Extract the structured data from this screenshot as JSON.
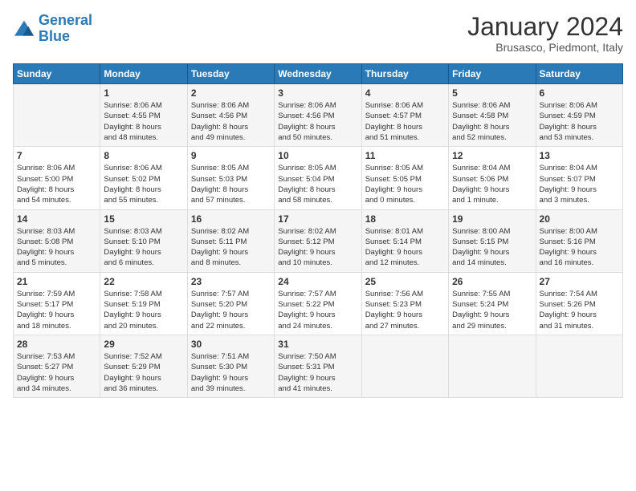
{
  "header": {
    "logo_line1": "General",
    "logo_line2": "Blue",
    "month_title": "January 2024",
    "subtitle": "Brusasco, Piedmont, Italy"
  },
  "days_of_week": [
    "Sunday",
    "Monday",
    "Tuesday",
    "Wednesday",
    "Thursday",
    "Friday",
    "Saturday"
  ],
  "weeks": [
    [
      {
        "day": "",
        "info": ""
      },
      {
        "day": "1",
        "info": "Sunrise: 8:06 AM\nSunset: 4:55 PM\nDaylight: 8 hours\nand 48 minutes."
      },
      {
        "day": "2",
        "info": "Sunrise: 8:06 AM\nSunset: 4:56 PM\nDaylight: 8 hours\nand 49 minutes."
      },
      {
        "day": "3",
        "info": "Sunrise: 8:06 AM\nSunset: 4:56 PM\nDaylight: 8 hours\nand 50 minutes."
      },
      {
        "day": "4",
        "info": "Sunrise: 8:06 AM\nSunset: 4:57 PM\nDaylight: 8 hours\nand 51 minutes."
      },
      {
        "day": "5",
        "info": "Sunrise: 8:06 AM\nSunset: 4:58 PM\nDaylight: 8 hours\nand 52 minutes."
      },
      {
        "day": "6",
        "info": "Sunrise: 8:06 AM\nSunset: 4:59 PM\nDaylight: 8 hours\nand 53 minutes."
      }
    ],
    [
      {
        "day": "7",
        "info": "Sunrise: 8:06 AM\nSunset: 5:00 PM\nDaylight: 8 hours\nand 54 minutes."
      },
      {
        "day": "8",
        "info": "Sunrise: 8:06 AM\nSunset: 5:02 PM\nDaylight: 8 hours\nand 55 minutes."
      },
      {
        "day": "9",
        "info": "Sunrise: 8:05 AM\nSunset: 5:03 PM\nDaylight: 8 hours\nand 57 minutes."
      },
      {
        "day": "10",
        "info": "Sunrise: 8:05 AM\nSunset: 5:04 PM\nDaylight: 8 hours\nand 58 minutes."
      },
      {
        "day": "11",
        "info": "Sunrise: 8:05 AM\nSunset: 5:05 PM\nDaylight: 9 hours\nand 0 minutes."
      },
      {
        "day": "12",
        "info": "Sunrise: 8:04 AM\nSunset: 5:06 PM\nDaylight: 9 hours\nand 1 minute."
      },
      {
        "day": "13",
        "info": "Sunrise: 8:04 AM\nSunset: 5:07 PM\nDaylight: 9 hours\nand 3 minutes."
      }
    ],
    [
      {
        "day": "14",
        "info": "Sunrise: 8:03 AM\nSunset: 5:08 PM\nDaylight: 9 hours\nand 5 minutes."
      },
      {
        "day": "15",
        "info": "Sunrise: 8:03 AM\nSunset: 5:10 PM\nDaylight: 9 hours\nand 6 minutes."
      },
      {
        "day": "16",
        "info": "Sunrise: 8:02 AM\nSunset: 5:11 PM\nDaylight: 9 hours\nand 8 minutes."
      },
      {
        "day": "17",
        "info": "Sunrise: 8:02 AM\nSunset: 5:12 PM\nDaylight: 9 hours\nand 10 minutes."
      },
      {
        "day": "18",
        "info": "Sunrise: 8:01 AM\nSunset: 5:14 PM\nDaylight: 9 hours\nand 12 minutes."
      },
      {
        "day": "19",
        "info": "Sunrise: 8:00 AM\nSunset: 5:15 PM\nDaylight: 9 hours\nand 14 minutes."
      },
      {
        "day": "20",
        "info": "Sunrise: 8:00 AM\nSunset: 5:16 PM\nDaylight: 9 hours\nand 16 minutes."
      }
    ],
    [
      {
        "day": "21",
        "info": "Sunrise: 7:59 AM\nSunset: 5:17 PM\nDaylight: 9 hours\nand 18 minutes."
      },
      {
        "day": "22",
        "info": "Sunrise: 7:58 AM\nSunset: 5:19 PM\nDaylight: 9 hours\nand 20 minutes."
      },
      {
        "day": "23",
        "info": "Sunrise: 7:57 AM\nSunset: 5:20 PM\nDaylight: 9 hours\nand 22 minutes."
      },
      {
        "day": "24",
        "info": "Sunrise: 7:57 AM\nSunset: 5:22 PM\nDaylight: 9 hours\nand 24 minutes."
      },
      {
        "day": "25",
        "info": "Sunrise: 7:56 AM\nSunset: 5:23 PM\nDaylight: 9 hours\nand 27 minutes."
      },
      {
        "day": "26",
        "info": "Sunrise: 7:55 AM\nSunset: 5:24 PM\nDaylight: 9 hours\nand 29 minutes."
      },
      {
        "day": "27",
        "info": "Sunrise: 7:54 AM\nSunset: 5:26 PM\nDaylight: 9 hours\nand 31 minutes."
      }
    ],
    [
      {
        "day": "28",
        "info": "Sunrise: 7:53 AM\nSunset: 5:27 PM\nDaylight: 9 hours\nand 34 minutes."
      },
      {
        "day": "29",
        "info": "Sunrise: 7:52 AM\nSunset: 5:29 PM\nDaylight: 9 hours\nand 36 minutes."
      },
      {
        "day": "30",
        "info": "Sunrise: 7:51 AM\nSunset: 5:30 PM\nDaylight: 9 hours\nand 39 minutes."
      },
      {
        "day": "31",
        "info": "Sunrise: 7:50 AM\nSunset: 5:31 PM\nDaylight: 9 hours\nand 41 minutes."
      },
      {
        "day": "",
        "info": ""
      },
      {
        "day": "",
        "info": ""
      },
      {
        "day": "",
        "info": ""
      }
    ]
  ]
}
